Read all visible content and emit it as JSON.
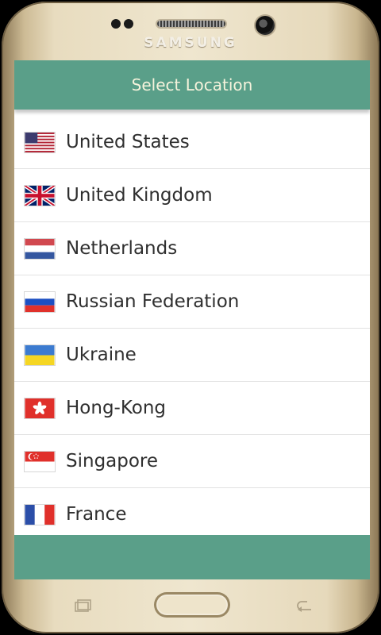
{
  "device": {
    "brand": "SAMSUNG"
  },
  "header": {
    "title": "Select Location"
  },
  "locations": [
    {
      "name": "United States",
      "flag": "us-flag-icon"
    },
    {
      "name": "United Kingdom",
      "flag": "uk-flag-icon"
    },
    {
      "name": "Netherlands",
      "flag": "nl-flag-icon"
    },
    {
      "name": "Russian Federation",
      "flag": "ru-flag-icon"
    },
    {
      "name": "Ukraine",
      "flag": "ua-flag-icon"
    },
    {
      "name": "Hong-Kong",
      "flag": "hk-flag-icon"
    },
    {
      "name": "Singapore",
      "flag": "sg-flag-icon"
    },
    {
      "name": "France",
      "flag": "fr-flag-icon"
    }
  ],
  "colors": {
    "accent": "#5a9f89",
    "header_text": "#f6f3dc"
  }
}
